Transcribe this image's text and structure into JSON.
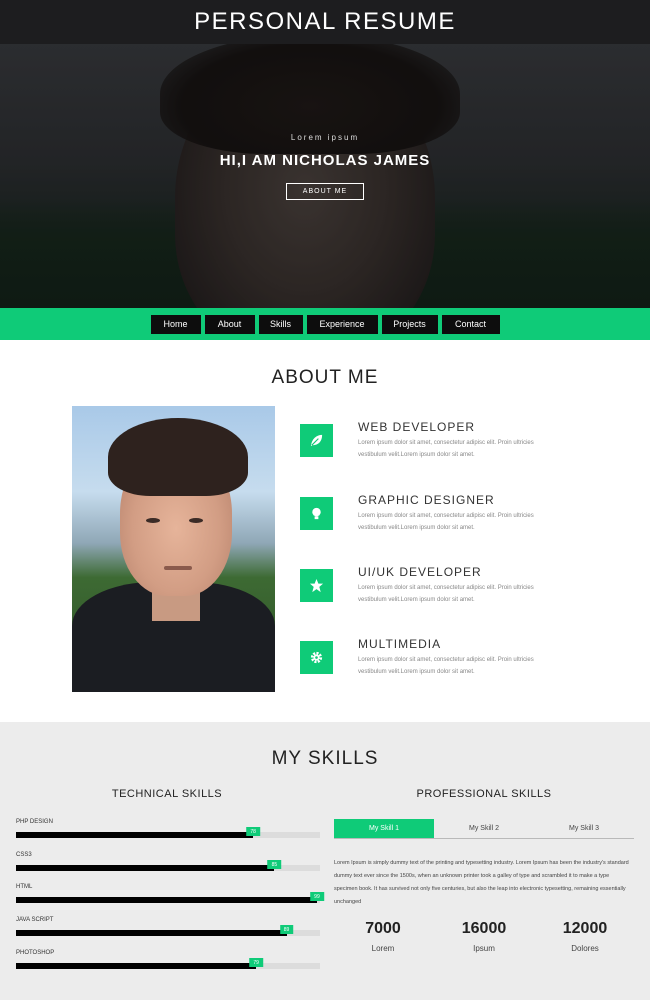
{
  "header": {
    "title": "PERSONAL RESUME"
  },
  "hero": {
    "kicker": "Lorem ipsum",
    "name": "HI,I AM NICHOLAS JAMES",
    "button_label": "ABOUT ME"
  },
  "nav": {
    "items": [
      {
        "label": "Home"
      },
      {
        "label": "About"
      },
      {
        "label": "Skills"
      },
      {
        "label": "Experience"
      },
      {
        "label": "Projects"
      },
      {
        "label": "Contact"
      }
    ]
  },
  "about": {
    "title": "ABOUT ME",
    "roles": [
      {
        "title": "WEB DEVELOPER",
        "icon": "leaf-icon",
        "text": "Lorem ipsum dolor sit amet, consectetur adipisc elit. Proin ultricies vestibulum velit.Lorem ipsum dolor sit amet."
      },
      {
        "title": "GRAPHIC DESIGNER",
        "icon": "lightbulb-icon",
        "text": "Lorem ipsum dolor sit amet, consectetur adipisc elit. Proin ultricies vestibulum velit.Lorem ipsum dolor sit amet."
      },
      {
        "title": "UI/UK DEVELOPER",
        "icon": "star-icon",
        "text": "Lorem ipsum dolor sit amet, consectetur adipisc elit. Proin ultricies vestibulum velit.Lorem ipsum dolor sit amet."
      },
      {
        "title": "MULTIMEDIA",
        "icon": "gear-icon",
        "text": "Lorem ipsum dolor sit amet, consectetur adipisc elit. Proin ultricies vestibulum velit.Lorem ipsum dolor sit amet."
      }
    ]
  },
  "skills": {
    "title": "MY SKILLS",
    "technical_title": "TECHNICAL SKILLS",
    "professional_title": "PROFESSIONAL SKILLS",
    "technical": [
      {
        "label": "PHP DESIGN",
        "percent": 78,
        "badge": "78"
      },
      {
        "label": "CSS3",
        "percent": 85,
        "badge": "85"
      },
      {
        "label": "HTML",
        "percent": 99,
        "badge": "99"
      },
      {
        "label": "JAVA SCRIPT",
        "percent": 89,
        "badge": "89"
      },
      {
        "label": "PHOTOSHOP",
        "percent": 79,
        "badge": "79"
      }
    ],
    "tabs": [
      {
        "label": "My Skill 1",
        "active": true
      },
      {
        "label": "My Skill 2",
        "active": false
      },
      {
        "label": "My Skill 3",
        "active": false
      }
    ],
    "description": "Lorem Ipsum is simply dummy text of the printing and typesetting industry. Lorem Ipsum has been the industry's standard dummy text ever since the 1500s, when an unknown printer took a galley of type and scrambled it to make a type specimen book. It has survived not only five centuries, but also the leap into electronic typesetting, remaining essentially unchanged",
    "stats": [
      {
        "value": "7000",
        "caption": "Lorem"
      },
      {
        "value": "16000",
        "caption": "Ipsum"
      },
      {
        "value": "12000",
        "caption": "Dolores"
      }
    ]
  },
  "colors": {
    "accent": "#0fcb78",
    "dark": "#1d1d1f"
  }
}
